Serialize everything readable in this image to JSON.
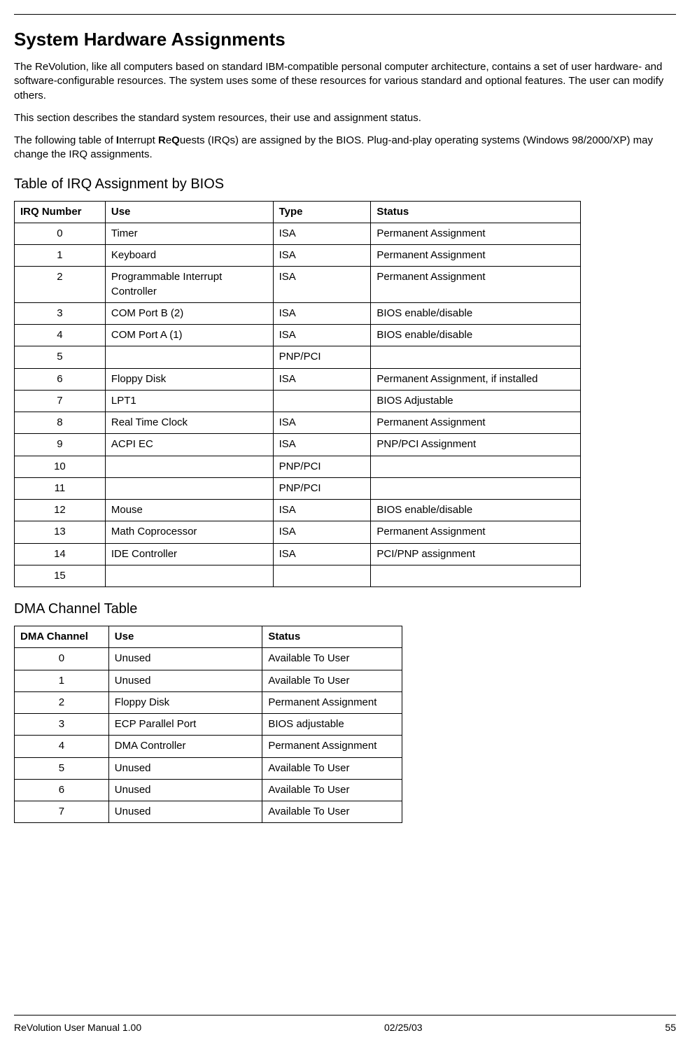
{
  "header": {
    "title": "System Hardware Assignments"
  },
  "intro": {
    "para1": "The ReVolution, like all computers based on standard IBM-compatible personal computer architecture, contains a set of user hardware- and software-configurable resources. The system uses some of these resources for various standard and optional features. The user can modify others.",
    "para2": "This section describes the standard system resources, their use and assignment status.",
    "para3_pre": "The following table of ",
    "para3_i": "I",
    "para3_mid1": "nterrupt ",
    "para3_r": "R",
    "para3_mid2": "e",
    "para3_q": "Q",
    "para3_post": "uests (IRQs) are assigned by the BIOS. Plug-and-play operating systems (Windows 98/2000/XP) may change the IRQ assignments."
  },
  "irq": {
    "heading": "Table of IRQ Assignment by BIOS",
    "cols": [
      "IRQ Number",
      "Use",
      "Type",
      "Status"
    ],
    "rows": [
      {
        "n": "0",
        "use": "Timer",
        "type": "ISA",
        "status": "Permanent Assignment"
      },
      {
        "n": "1",
        "use": "Keyboard",
        "type": "ISA",
        "status": "Permanent Assignment"
      },
      {
        "n": "2",
        "use": "Programmable Interrupt Controller",
        "type": "ISA",
        "status": "Permanent Assignment"
      },
      {
        "n": "3",
        "use": "COM Port B (2)",
        "type": "ISA",
        "status": "BIOS enable/disable"
      },
      {
        "n": "4",
        "use": "COM Port A (1)",
        "type": "ISA",
        "status": "BIOS enable/disable"
      },
      {
        "n": "5",
        "use": "",
        "type": "PNP/PCI",
        "status": ""
      },
      {
        "n": "6",
        "use": "Floppy Disk",
        "type": "ISA",
        "status": "Permanent Assignment, if installed"
      },
      {
        "n": "7",
        "use": "LPT1",
        "type": "",
        "status": "BIOS Adjustable"
      },
      {
        "n": "8",
        "use": "Real Time Clock",
        "type": "ISA",
        "status": "Permanent Assignment"
      },
      {
        "n": "9",
        "use": "ACPI EC",
        "type": "ISA",
        "status": "PNP/PCI Assignment"
      },
      {
        "n": "10",
        "use": "",
        "type": "PNP/PCI",
        "status": ""
      },
      {
        "n": "11",
        "use": "",
        "type": "PNP/PCI",
        "status": ""
      },
      {
        "n": "12",
        "use": "Mouse",
        "type": "ISA",
        "status": "BIOS enable/disable"
      },
      {
        "n": "13",
        "use": "Math Coprocessor",
        "type": "ISA",
        "status": "Permanent Assignment"
      },
      {
        "n": "14",
        "use": "IDE Controller",
        "type": "ISA",
        "status": "PCI/PNP assignment"
      },
      {
        "n": "15",
        "use": "",
        "type": "",
        "status": ""
      }
    ]
  },
  "dma": {
    "heading": "DMA Channel Table",
    "cols": [
      "DMA Channel",
      "Use",
      "Status"
    ],
    "rows": [
      {
        "n": "0",
        "use": "Unused",
        "status": "Available To User"
      },
      {
        "n": "1",
        "use": "Unused",
        "status": "Available To User"
      },
      {
        "n": "2",
        "use": "Floppy Disk",
        "status": "Permanent Assignment"
      },
      {
        "n": "3",
        "use": "ECP Parallel Port",
        "status": "BIOS adjustable"
      },
      {
        "n": "4",
        "use": "DMA Controller",
        "status": "Permanent Assignment"
      },
      {
        "n": "5",
        "use": "Unused",
        "status": "Available To User"
      },
      {
        "n": "6",
        "use": "Unused",
        "status": "Available To User"
      },
      {
        "n": "7",
        "use": "Unused",
        "status": "Available To User"
      }
    ]
  },
  "footer": {
    "left": "ReVolution User Manual 1.00",
    "center": "02/25/03",
    "right": "55"
  }
}
